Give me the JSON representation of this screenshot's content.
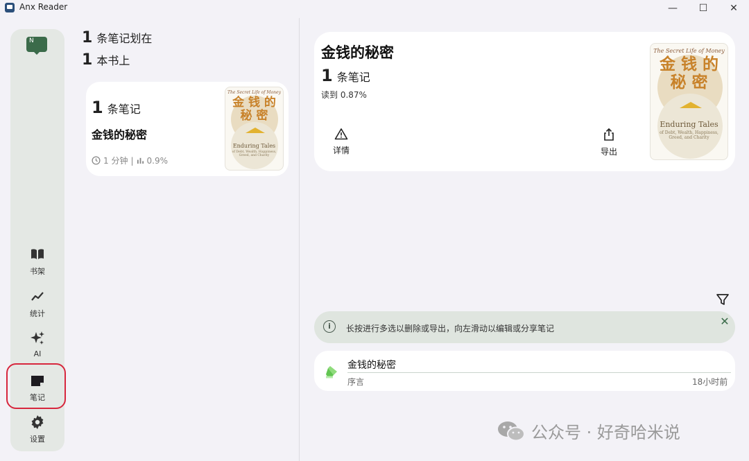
{
  "window": {
    "title": "Anx Reader",
    "controls": {
      "minimize": "—",
      "maximize": "☐",
      "close": "✕"
    }
  },
  "nav": {
    "logo": "N",
    "items": [
      {
        "label": "书架",
        "icon": "book-open-icon"
      },
      {
        "label": "统计",
        "icon": "trend-line-icon"
      },
      {
        "label": "AI",
        "icon": "sparkle-icon"
      },
      {
        "label": "笔记",
        "icon": "note-icon",
        "active": true
      },
      {
        "label": "设置",
        "icon": "gear-icon"
      }
    ],
    "highlight_color": "#d7263d"
  },
  "summary": {
    "notes_count": "1",
    "notes_suffix": "条笔记划在",
    "books_count": "1",
    "books_suffix": "本书上"
  },
  "book_card": {
    "count": "1",
    "count_suffix": "条笔记",
    "title": "金钱的秘密",
    "read_time": "1 分钟",
    "separator": "|",
    "progress": "0.9%"
  },
  "cover": {
    "top_en": "The Secret Life of Money",
    "big_cn_1": "金 钱 的",
    "big_cn_2": "秘   密",
    "en_title": "Enduring Tales",
    "en_sub": "of Debt, Wealth, Happiness, Greed, and Charity"
  },
  "detail": {
    "title": "金钱的秘密",
    "count": "1",
    "count_suffix": "条笔记",
    "progress": "读到 0.87%",
    "actions": {
      "details": "详情",
      "export": "导出"
    }
  },
  "tip": {
    "text": "长按进行多选以删除或导出，向左滑动以编辑或分享笔记",
    "info_glyph": "i",
    "close_glyph": "✕"
  },
  "note": {
    "title": "金钱的秘密",
    "chapter": "序言",
    "time": "18小时前"
  },
  "watermark": {
    "text": "公众号 · 好奇哈米说"
  },
  "colors": {
    "accent": "#3b6b4a",
    "rail_bg": "#e4e8e4",
    "tip_bg": "#dfe5df",
    "card_bg": "#ffffff",
    "page_bg": "#f3f2f7"
  }
}
